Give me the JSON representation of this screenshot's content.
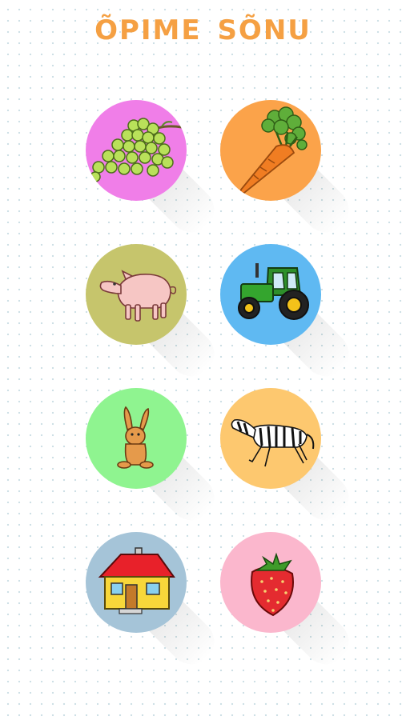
{
  "app": {
    "title": "ÕPIME SÕNU",
    "title_color": "#f5a043"
  },
  "tiles": [
    {
      "icon": "grapes-icon",
      "color": "#f07ee8"
    },
    {
      "icon": "carrot-icon",
      "color": "#fba34a"
    },
    {
      "icon": "pig-icon",
      "color": "#c6c56c"
    },
    {
      "icon": "tractor-icon",
      "color": "#5fb9f2"
    },
    {
      "icon": "rabbit-icon",
      "color": "#8ff490"
    },
    {
      "icon": "zebra-icon",
      "color": "#fdc86f"
    },
    {
      "icon": "house-icon",
      "color": "#a5c4d8"
    },
    {
      "icon": "strawberry-icon",
      "color": "#fbb7cd"
    }
  ]
}
